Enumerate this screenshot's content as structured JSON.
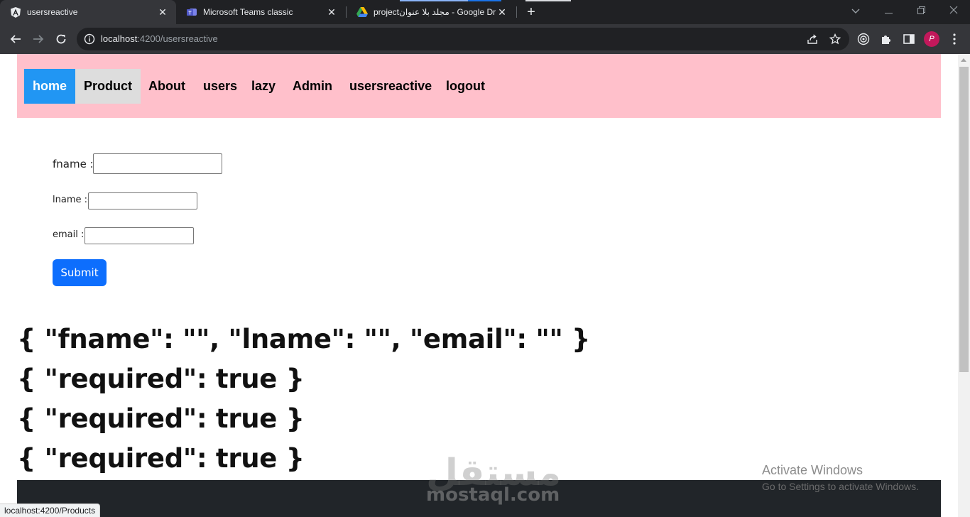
{
  "browser": {
    "tabs": [
      {
        "title": "usersreactive",
        "icon": "angular-icon",
        "active": true
      },
      {
        "title": "Microsoft Teams classic",
        "icon": "teams-icon",
        "active": false
      },
      {
        "title": "projectمجلد بلا عنوان - Google Dr",
        "icon": "google-drive-icon",
        "active": false
      }
    ],
    "new_tab_label": "+",
    "url_host": "localhost",
    "url_rest": ":4200/usersreactive",
    "profile_initial": "P",
    "status_url": "localhost:4200/Products"
  },
  "navbar": {
    "background": "#ffc0cb",
    "links": [
      {
        "label": "home",
        "state": "active"
      },
      {
        "label": "Product",
        "state": "hover"
      },
      {
        "label": "About",
        "state": "normal"
      },
      {
        "label": "users",
        "state": "normal"
      },
      {
        "label": "lazy",
        "state": "normal"
      },
      {
        "label": "Admin",
        "state": "normal"
      },
      {
        "label": "usersreactive",
        "state": "normal"
      },
      {
        "label": "logout",
        "state": "normal"
      }
    ]
  },
  "form": {
    "fname_label": "fname :-",
    "fname_value": "",
    "lname_label": "lname :-",
    "lname_value": "",
    "email_label": "email :-",
    "email_value": "",
    "submit_label": "Submit",
    "submit_color": "#0d6efd"
  },
  "output": {
    "lines": [
      "{ \"fname\": \"\", \"lname\": \"\", \"email\": \"\" }",
      "{ \"required\": true }",
      "{ \"required\": true }",
      "{ \"required\": true }"
    ]
  },
  "overlay": {
    "watermark_ar": "مستقل",
    "watermark_en": "mostaql.com",
    "activate_title": "Activate Windows",
    "activate_sub": "Go to Settings to activate Windows."
  }
}
